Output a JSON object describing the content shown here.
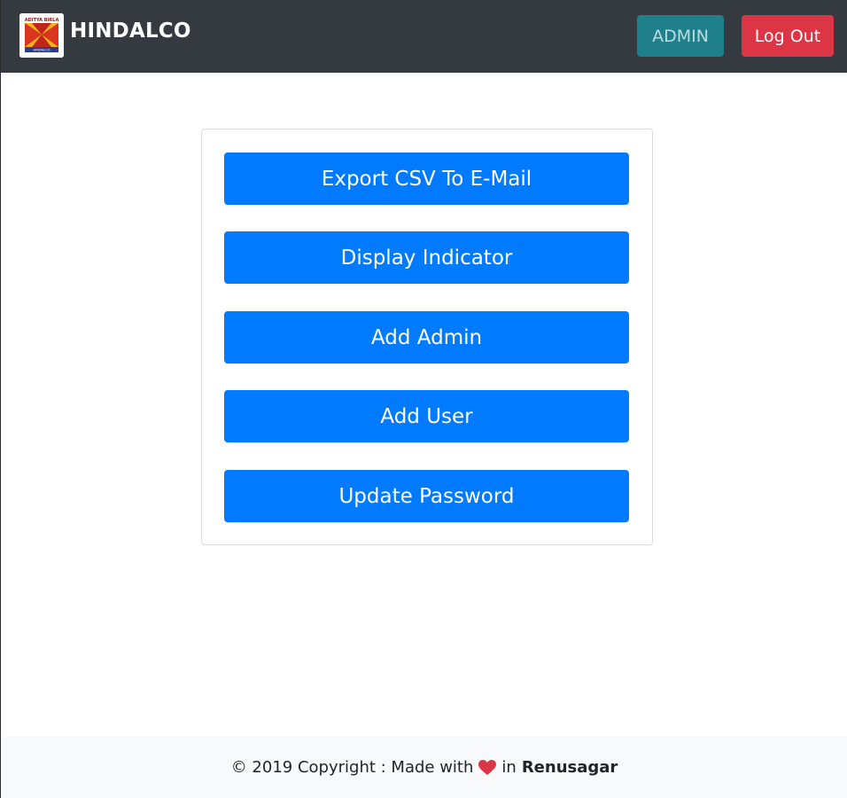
{
  "navbar": {
    "brand_name": "HINDALCO",
    "logo_text_top": "ADITYA BIRLA",
    "logo_text_bottom": "HINDALCO",
    "admin_label": "ADMIN",
    "logout_label": "Log Out"
  },
  "actions": [
    {
      "label": "Export CSV To E-Mail"
    },
    {
      "label": "Display Indicator"
    },
    {
      "label": "Add Admin"
    },
    {
      "label": "Add User"
    },
    {
      "label": "Update Password"
    }
  ],
  "footer": {
    "text_before": "© 2019 Copyright : Made with",
    "text_in": "in",
    "location": "Renusagar",
    "heart_icon": "heart-icon"
  },
  "colors": {
    "navbar_bg": "#343a40",
    "primary": "#007bff",
    "info": "#1f7f8b",
    "danger": "#dc3545",
    "footer_bg": "#f8f9fa"
  }
}
